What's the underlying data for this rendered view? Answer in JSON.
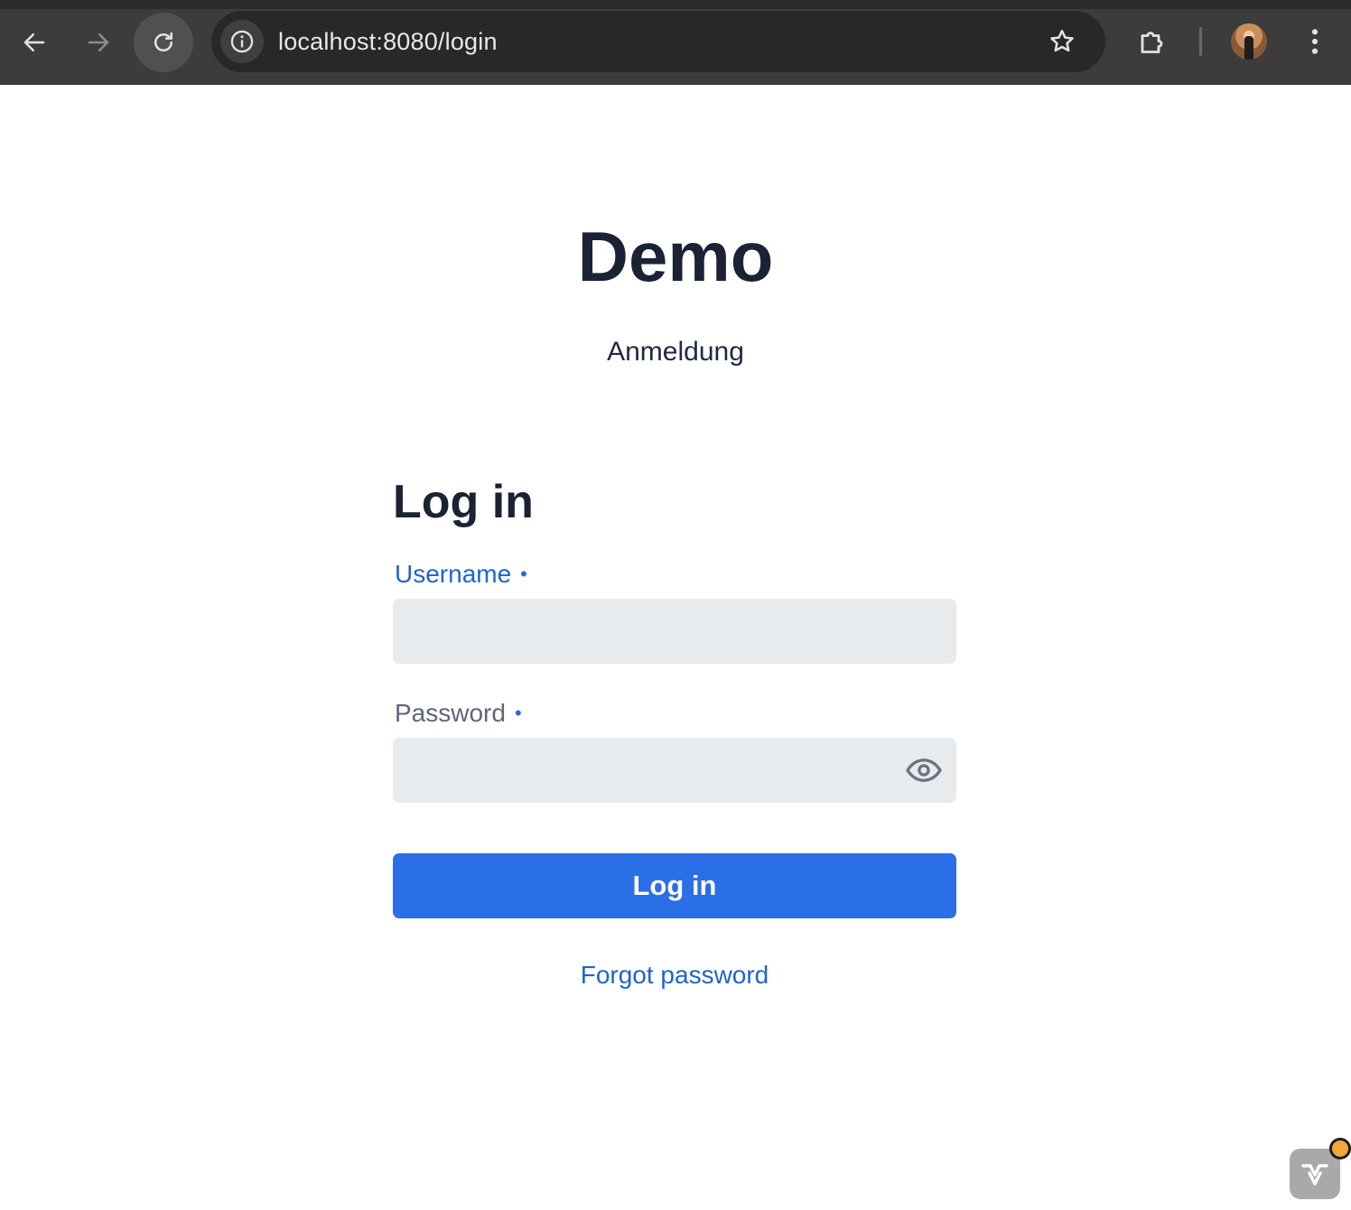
{
  "browser": {
    "url": "localhost:8080/login",
    "icons": {
      "back": "arrow-left-icon",
      "forward": "arrow-right-icon",
      "reload": "reload-icon",
      "site_info": "info-icon",
      "bookmark": "star-icon",
      "extensions": "puzzle-icon",
      "profile": "avatar",
      "menu": "kebab-menu-icon"
    }
  },
  "brand": {
    "title": "Demo",
    "subtitle": "Anmeldung"
  },
  "login_form": {
    "heading": "Log in",
    "username_label": "Username",
    "password_label": "Password",
    "required_marker": "•",
    "username_value": "",
    "password_value": "",
    "submit_label": "Log in",
    "forgot_label": "Forgot password"
  },
  "colors": {
    "accent": "#2a6ee8",
    "link": "#1f63d3",
    "heading": "#1a2233",
    "input_bg": "#e8ebee",
    "chrome_bg": "#3c3c3c"
  }
}
